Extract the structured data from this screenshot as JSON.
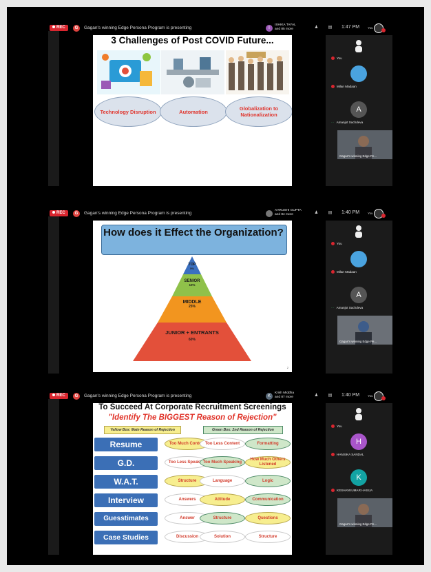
{
  "panels": [
    {
      "rec_label": "REC",
      "presenter_initial": "G",
      "presenting_text": "Gagan's winning Edge Persona Program is presenting",
      "presenter_avatar_initial": "I",
      "presenter_avatar_color": "#9b59b6",
      "presenter_name_line1": "ISHIKA TAYAL",
      "presenter_name_line2": "and 85 more",
      "time": "1:47 PM",
      "you_label": "You",
      "participants": [
        {
          "label": "You"
        },
        {
          "label": "Milan Madaan"
        },
        {
          "label": "Amanjot Sachdeva",
          "initial": "A",
          "color": "#555555"
        },
        {
          "label": "Gagan's winning Edge Pe..."
        }
      ],
      "slide": {
        "title": "3 Challenges of Post COVID Future...",
        "ovals": [
          "Technology Disruption",
          "Automation",
          "Globalization to Nationalization"
        ]
      }
    },
    {
      "rec_label": "REC",
      "presenter_initial": "G",
      "presenting_text": "Gagan's winning Edge Persona Program is presenting",
      "presenter_avatar_initial": "",
      "presenter_avatar_color": "#777777",
      "presenter_name_line1": "AARUSHI GUPTA",
      "presenter_name_line2": "and 84 more",
      "time": "1:40 PM",
      "you_label": "You",
      "participants": [
        {
          "label": "You"
        },
        {
          "label": "Milan Madaan"
        },
        {
          "label": "Amanjot Sachdeva",
          "initial": "A",
          "color": "#555555"
        },
        {
          "label": "Gagan's winning Edge Pe..."
        }
      ],
      "slide": {
        "title": "How does it Effect the Organization?",
        "tiers": [
          {
            "name": "TOP",
            "pct": "5%",
            "color": "#3a6fbf"
          },
          {
            "name": "SENIOR",
            "pct": "10%",
            "color": "#8fc14a"
          },
          {
            "name": "MIDDLE",
            "pct": "25%",
            "color": "#f2951f"
          },
          {
            "name": "JUNIOR + ENTRANTS",
            "pct": "60%",
            "color": "#e3503a"
          }
        ],
        "page_number": "2"
      }
    },
    {
      "rec_label": "REC",
      "presenter_initial": "G",
      "presenting_text": "Gagan's winning Edge Persona Program is presenting",
      "presenter_avatar_initial": "K",
      "presenter_avatar_color": "#5a6b7b",
      "presenter_name_line1": "Krish Middha",
      "presenter_name_line2": "and 87 more",
      "time": "1:40 PM",
      "you_label": "You",
      "participants": [
        {
          "label": "You"
        },
        {
          "label": "HANSIKA SANDAL",
          "initial": "H",
          "color": "#a855c9"
        },
        {
          "label": "KESHAVKUMAR HASIJA",
          "initial": "K",
          "color": "#13a3a3"
        },
        {
          "label": "Gagan's winning Edge Pe..."
        }
      ],
      "slide": {
        "title": "To Succeed At Corporate Recruitment Screenings",
        "subtitle": "\"Identify The BIGGEST Reason of Rejection\"",
        "legend_yellow": "Yellow Box: Main Reason of Rejection",
        "legend_green": "Green Box: 2nd Reason of Rejection",
        "rows": [
          {
            "label": "Resume",
            "cells": [
              {
                "t": "Too Much Content",
                "c": "y"
              },
              {
                "t": "Too Less Content",
                "c": "w"
              },
              {
                "t": "Formatting",
                "c": "g"
              }
            ]
          },
          {
            "label": "G.D.",
            "cells": [
              {
                "t": "Too Less Speaking",
                "c": "w"
              },
              {
                "t": "Too Much Speaking",
                "c": "g"
              },
              {
                "t": "How Much Others Listened",
                "c": "y"
              }
            ]
          },
          {
            "label": "W.A.T.",
            "cells": [
              {
                "t": "Structure",
                "c": "y"
              },
              {
                "t": "Language",
                "c": "w"
              },
              {
                "t": "Logic",
                "c": "g"
              }
            ]
          },
          {
            "label": "Interview",
            "cells": [
              {
                "t": "Answers",
                "c": "w"
              },
              {
                "t": "Attitude",
                "c": "y"
              },
              {
                "t": "Communication",
                "c": "g"
              }
            ]
          },
          {
            "label": "Guesstimates",
            "cells": [
              {
                "t": "Answer",
                "c": "w"
              },
              {
                "t": "Structure",
                "c": "g"
              },
              {
                "t": "Questions",
                "c": "y"
              }
            ]
          },
          {
            "label": "Case Studies",
            "cells": [
              {
                "t": "Discussion",
                "c": "w"
              },
              {
                "t": "Solution",
                "c": "w"
              },
              {
                "t": "Structure",
                "c": "w"
              }
            ]
          }
        ]
      }
    }
  ]
}
